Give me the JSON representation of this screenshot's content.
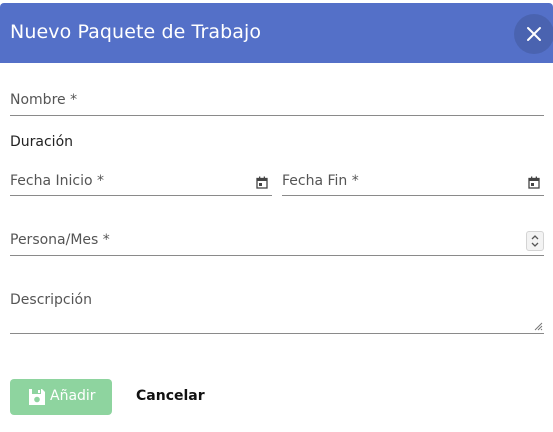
{
  "dialog": {
    "title": "Nuevo Paquete de Trabajo",
    "close_icon": "close-icon"
  },
  "form": {
    "nombre": {
      "label": "Nombre *",
      "value": ""
    },
    "duracion_heading": "Duración",
    "fecha_inicio": {
      "label": "Fecha Inicio *",
      "value": "",
      "icon": "calendar-icon"
    },
    "fecha_fin": {
      "label": "Fecha Fin *",
      "value": "",
      "icon": "calendar-icon"
    },
    "persona_mes": {
      "label": "Persona/Mes *",
      "value": "",
      "icon": "spinner-icon"
    },
    "descripcion": {
      "label": "Descripción",
      "value": "",
      "icon": "resize-handle-icon"
    }
  },
  "actions": {
    "add_label": "Añadir",
    "add_icon": "save-icon",
    "cancel_label": "Cancelar"
  },
  "colors": {
    "header": "#5470c8",
    "close_button": "#4a63b0",
    "add_button": "#8ed49f"
  }
}
